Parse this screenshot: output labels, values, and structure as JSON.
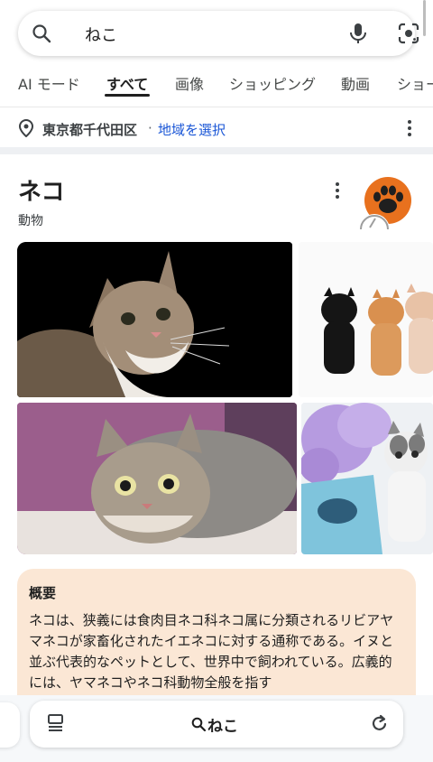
{
  "search": {
    "query": "ねこ",
    "icons": [
      "search-icon",
      "mic-icon",
      "lens-icon"
    ]
  },
  "tabs": [
    {
      "label": "AI モード"
    },
    {
      "label": "すべて",
      "active": true
    },
    {
      "label": "画像"
    },
    {
      "label": "ショッピング"
    },
    {
      "label": "動画"
    },
    {
      "label": "ショー"
    }
  ],
  "location": {
    "city": "東京都千代田区",
    "separator": "·",
    "select_label": "地域を選択",
    "link_color": "#1a56d6"
  },
  "knowledge_panel": {
    "title": "ネコ",
    "subtitle": "動物",
    "logo_icon": "paw-icon",
    "logo_color": "#e8711e"
  },
  "photos": [
    {
      "alt_icon": "cat-photo"
    },
    {
      "alt_icon": "kittens-photo"
    },
    {
      "alt_icon": "tabby-cat-photo"
    },
    {
      "alt_icon": "kitten-flowers-photo"
    }
  ],
  "overview": {
    "heading": "概要",
    "text": "ネコは、狭義には食肉目ネコ科ネコ属に分類されるリビアヤマネコが家畜化されたイエネコに対する通称である。イヌと並ぶ代表的なペットとして、世界中で飼われている。広義的には、ヤマネコやネコ科動物全般を指す",
    "background": "#fbe7d5"
  },
  "bottom_bar": {
    "query": "ねこ"
  }
}
